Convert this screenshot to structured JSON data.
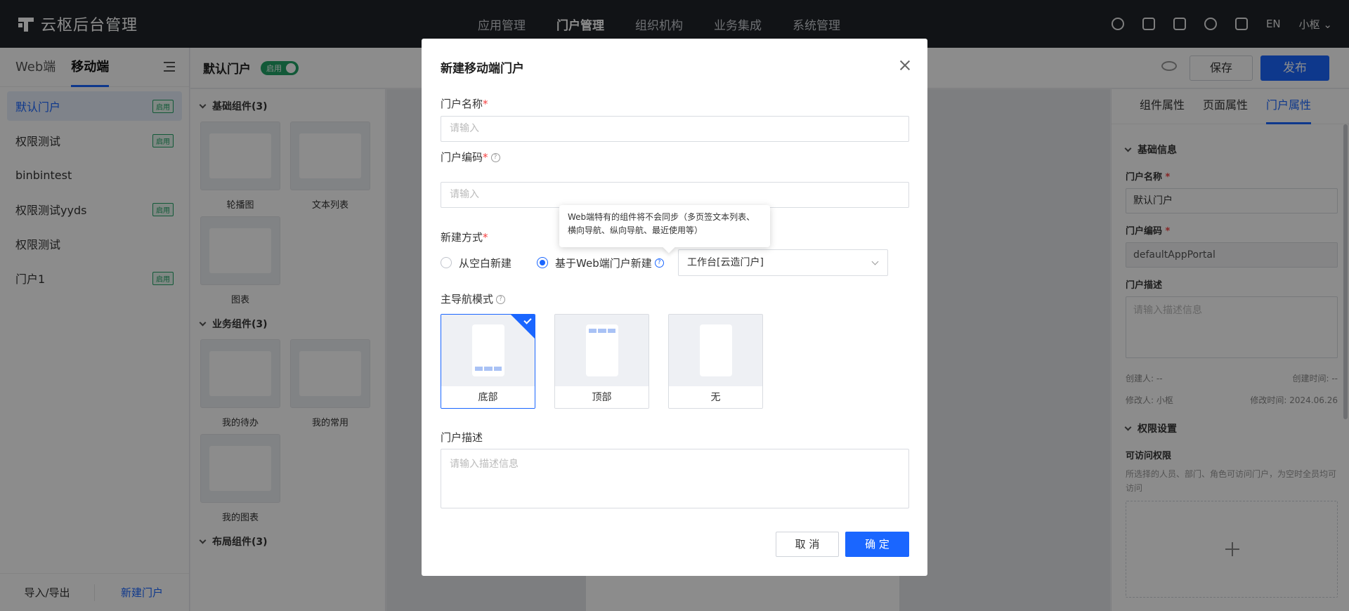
{
  "app": {
    "title": "云枢后台管理"
  },
  "topnav": [
    "应用管理",
    "门户管理",
    "组织机构",
    "业务集成",
    "系统管理"
  ],
  "topright": {
    "lang": "EN",
    "user": "小枢"
  },
  "left": {
    "tabs": [
      "Web端",
      "移动端"
    ],
    "portals": [
      {
        "name": "默认门户",
        "badge": "启用"
      },
      {
        "name": "权限测试",
        "badge": "启用"
      },
      {
        "name": "binbintest",
        "badge": ""
      },
      {
        "name": "权限测试yyds",
        "badge": "启用"
      },
      {
        "name": "权限测试",
        "badge": ""
      },
      {
        "name": "门户1",
        "badge": "启用"
      }
    ],
    "footer": {
      "import_export": "导入/导出",
      "new_portal": "新建门户"
    }
  },
  "editor": {
    "title": "默认门户",
    "status": "启用",
    "save": "保存",
    "publish": "发布"
  },
  "library": {
    "basic_title": "基础组件(3)",
    "basic": [
      "轮播图",
      "文本列表",
      "图表"
    ],
    "business_title": "业务组件(3)",
    "business": [
      "我的待办",
      "我的常用",
      "我的图表"
    ],
    "layout_title": "布局组件(3)"
  },
  "right": {
    "tabs": [
      "组件属性",
      "页面属性",
      "门户属性"
    ],
    "basic_info": "基础信息",
    "name_label": "门户名称",
    "name_value": "默认门户",
    "code_label": "门户编码",
    "code_value": "defaultAppPortal",
    "desc_label": "门户描述",
    "desc_placeholder": "请输入描述信息",
    "creator": "创建人: --",
    "created_time": "创建时间: --",
    "modifier": "修改人: 小枢",
    "modified_time": "修改时间: 2024.06.26",
    "perm_title": "权限设置",
    "access_label": "可访问权限",
    "access_hint": "所选择的人员、部门、角色可访问门户，为空时全员均可访问"
  },
  "modal": {
    "title": "新建移动端门户",
    "name_label": "门户名称",
    "name_placeholder": "请输入",
    "code_label": "门户编码",
    "code_placeholder": "请输入",
    "method_label": "新建方式",
    "method_blank": "从空白新建",
    "method_web": "基于Web端门户新建",
    "method_selected": "基于Web端门户新建",
    "web_portal_value": "工作台[云造门户]",
    "tooltip": "Web端特有的组件将不会同步（多页签文本列表、横向导航、纵向导航、最近使用等）",
    "nav_label": "主导航模式",
    "nav_options": [
      "底部",
      "顶部",
      "无"
    ],
    "nav_selected": "底部",
    "desc_label": "门户描述",
    "desc_placeholder": "请输入描述信息",
    "cancel": "取 消",
    "ok": "确 定"
  },
  "colors": {
    "primary": "#1a66ff",
    "success": "#21a366",
    "topbar": "#1f2329",
    "required": "#f53f3f"
  }
}
